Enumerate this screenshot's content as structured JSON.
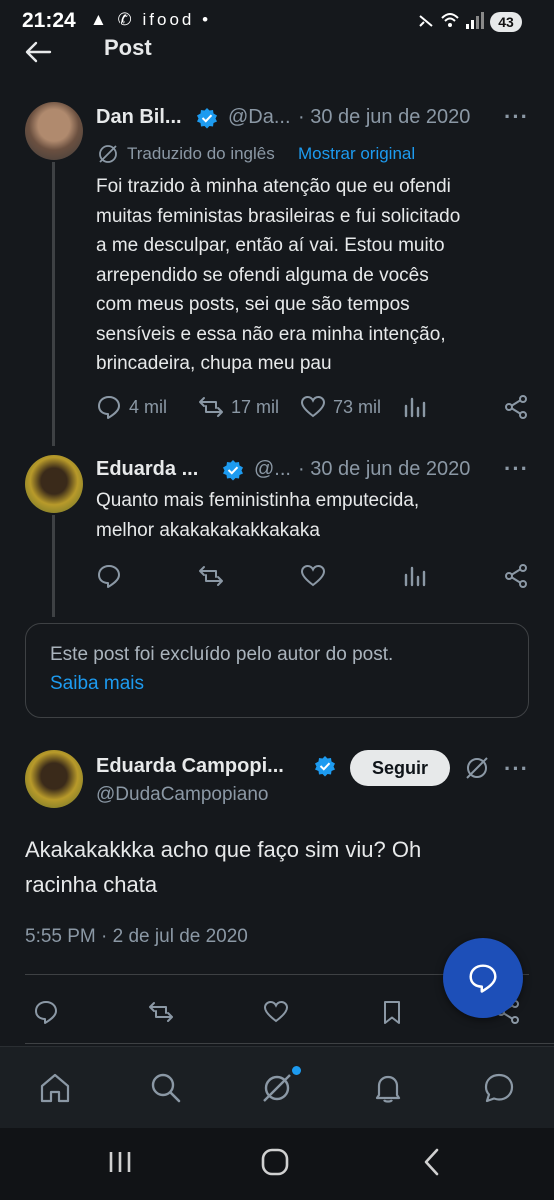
{
  "status_bar": {
    "time": "21:24",
    "left_icons": "▲ ✆ ifood •",
    "battery": "43"
  },
  "header": {
    "title": "Post"
  },
  "post1": {
    "author_name": "Dan Bil...",
    "handle": "@Da...",
    "date": "· 30 de jun de 2020",
    "translated_label": "Traduzido do inglês",
    "show_original": "Mostrar original",
    "text_lines": [
      "Foi trazido à minha atenção que eu ofendi",
      "muitas feministas brasileiras e fui solicitado",
      "a me desculpar, então aí vai. Estou muito",
      "arrependido se ofendi alguma de vocês",
      "com meus posts, sei que são tempos",
      "sensíveis e essa não era minha intenção,",
      "brincadeira, chupa meu pau"
    ],
    "replies": "4 mil",
    "reposts": "17 mil",
    "likes": "73 mil"
  },
  "post2": {
    "author_name": "Eduarda ...",
    "handle": "@...",
    "date": "· 30 de jun de 2020",
    "text_lines": [
      "Quanto mais feministinha emputecida,",
      "melhor akakakakakkakaka"
    ]
  },
  "deleted_notice": {
    "text": "Este post foi excluído pelo autor do post.",
    "link": "Saiba mais"
  },
  "main_post": {
    "author_name": "Eduarda Campopi...",
    "handle": "@DudaCampopiano",
    "follow_label": "Seguir",
    "text_lines": [
      "Akakakakkka acho que faço sim viu? Oh",
      "racinha chata"
    ],
    "timestamp": "5:55 PM · 2 de jul de 2020"
  },
  "colors": {
    "accent": "#1d9bf0",
    "background": "#15181c",
    "fab": "#1d4fb8"
  }
}
